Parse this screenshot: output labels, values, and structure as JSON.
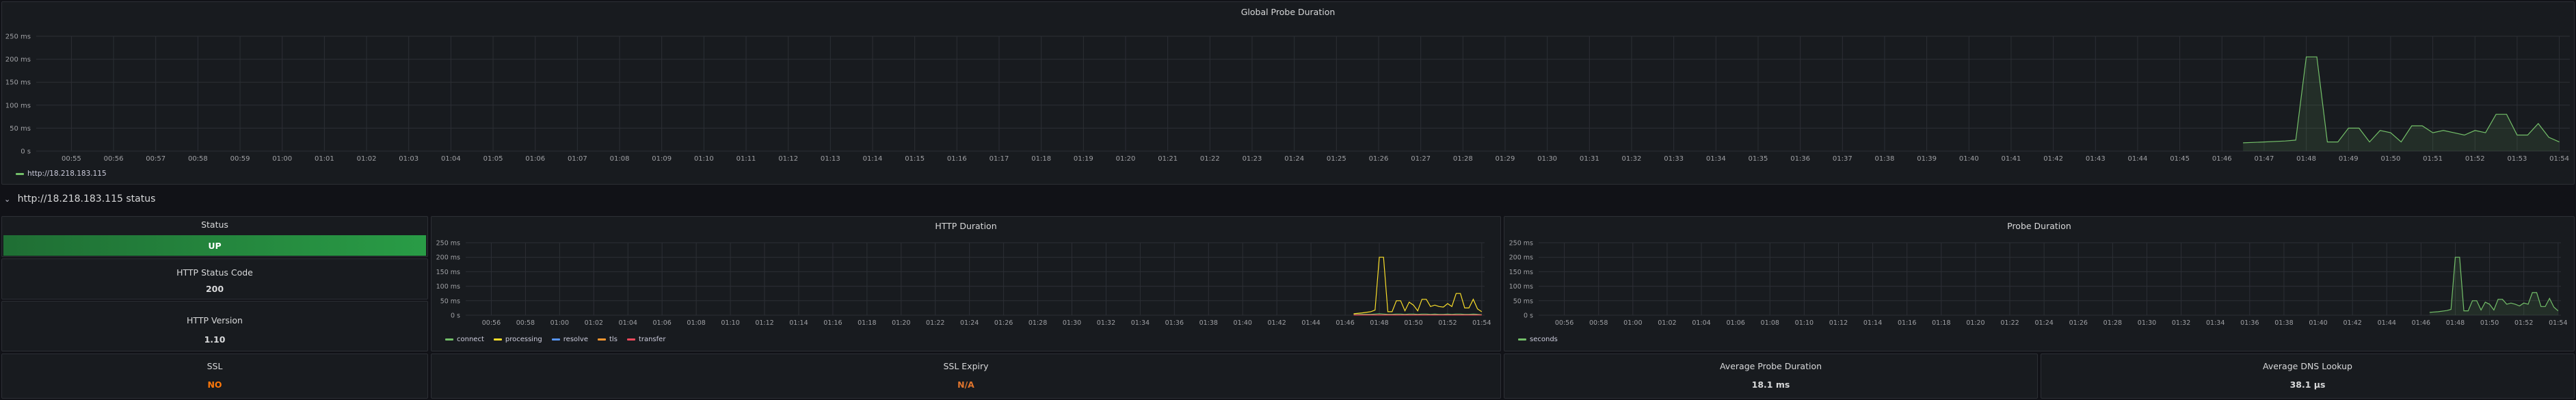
{
  "global_panel": {
    "title": "Global Probe Duration",
    "y_ticks": [
      "250 ms",
      "200 ms",
      "150 ms",
      "100 ms",
      "50 ms",
      "0 s"
    ],
    "x_ticks": [
      "00:55",
      "00:56",
      "00:57",
      "00:58",
      "00:59",
      "01:00",
      "01:01",
      "01:02",
      "01:03",
      "01:04",
      "01:05",
      "01:06",
      "01:07",
      "01:08",
      "01:09",
      "01:10",
      "01:11",
      "01:12",
      "01:13",
      "01:14",
      "01:15",
      "01:16",
      "01:17",
      "01:18",
      "01:19",
      "01:20",
      "01:21",
      "01:22",
      "01:23",
      "01:24",
      "01:25",
      "01:26",
      "01:27",
      "01:28",
      "01:29",
      "01:30",
      "01:31",
      "01:32",
      "01:33",
      "01:34",
      "01:35",
      "01:36",
      "01:37",
      "01:38",
      "01:39",
      "01:40",
      "01:41",
      "01:42",
      "01:43",
      "01:44",
      "01:45",
      "01:46",
      "01:47",
      "01:48",
      "01:49",
      "01:50",
      "01:51",
      "01:52",
      "01:53",
      "01:54"
    ],
    "legend": [
      "http://18.218.183.115"
    ],
    "color": "#73bf69"
  },
  "row": {
    "chevron": "v",
    "title": "http://18.218.183.115 status"
  },
  "status_panel": {
    "title": "Status",
    "value": "UP",
    "color": "#299c46"
  },
  "http_status_panel": {
    "title": "HTTP Status Code",
    "value": "200"
  },
  "http_version_panel": {
    "title": "HTTP Version",
    "value": "1.10"
  },
  "ssl_panel": {
    "title": "SSL",
    "value": "NO",
    "color": "#ff780a"
  },
  "ssl_expiry_panel": {
    "title": "SSL Expiry",
    "value": "N/A",
    "color": "#e0752d"
  },
  "avg_probe_panel": {
    "title": "Average Probe Duration",
    "value": "18.1 ms"
  },
  "avg_dns_panel": {
    "title": "Average DNS Lookup",
    "value": "38.1 µs"
  },
  "http_duration_panel": {
    "title": "HTTP Duration",
    "y_ticks": [
      "250 ms",
      "200 ms",
      "150 ms",
      "100 ms",
      "50 ms",
      "0 s"
    ],
    "x_ticks": [
      "00:56",
      "00:58",
      "01:00",
      "01:02",
      "01:04",
      "01:06",
      "01:08",
      "01:10",
      "01:12",
      "01:14",
      "01:16",
      "01:18",
      "01:20",
      "01:22",
      "01:24",
      "01:26",
      "01:28",
      "01:30",
      "01:32",
      "01:34",
      "01:36",
      "01:38",
      "01:40",
      "01:42",
      "01:44",
      "01:46",
      "01:48",
      "01:50",
      "01:52",
      "01:54"
    ],
    "legend": [
      {
        "name": "connect",
        "color": "#73bf69"
      },
      {
        "name": "processing",
        "color": "#fade2a"
      },
      {
        "name": "resolve",
        "color": "#5794f2"
      },
      {
        "name": "tls",
        "color": "#ff9830"
      },
      {
        "name": "transfer",
        "color": "#f2495c"
      }
    ]
  },
  "probe_duration_panel": {
    "title": "Probe Duration",
    "y_ticks": [
      "250 ms",
      "200 ms",
      "150 ms",
      "100 ms",
      "50 ms",
      "0 s"
    ],
    "x_ticks": [
      "00:56",
      "00:58",
      "01:00",
      "01:02",
      "01:04",
      "01:06",
      "01:08",
      "01:10",
      "01:12",
      "01:14",
      "01:16",
      "01:18",
      "01:20",
      "01:22",
      "01:24",
      "01:26",
      "01:28",
      "01:30",
      "01:32",
      "01:34",
      "01:36",
      "01:38",
      "01:40",
      "01:42",
      "01:44",
      "01:46",
      "01:48",
      "01:50",
      "01:52",
      "01:54"
    ],
    "legend": [
      {
        "name": "seconds",
        "color": "#73bf69"
      }
    ]
  },
  "chart_data": [
    {
      "type": "area",
      "title": "Global Probe Duration",
      "ylim": [
        0,
        250
      ],
      "x": [
        "01:46:30",
        "01:47",
        "01:47:30",
        "01:47:45",
        "01:48",
        "01:48:15",
        "01:48:30",
        "01:48:45",
        "01:49",
        "01:49:15",
        "01:49:30",
        "01:49:45",
        "01:50",
        "01:50:15",
        "01:50:30",
        "01:50:45",
        "01:51",
        "01:51:15",
        "01:51:30",
        "01:51:45",
        "01:52",
        "01:52:15",
        "01:52:30",
        "01:52:45",
        "01:53",
        "01:53:15",
        "01:53:30",
        "01:53:45",
        "01:54"
      ],
      "series": [
        {
          "name": "http://18.218.183.115",
          "values": [
            18,
            20,
            22,
            24,
            205,
            205,
            20,
            20,
            50,
            50,
            20,
            45,
            40,
            20,
            55,
            55,
            40,
            45,
            40,
            35,
            45,
            40,
            80,
            80,
            35,
            35,
            60,
            30,
            20
          ]
        }
      ]
    },
    {
      "type": "line",
      "title": "HTTP Duration",
      "ylim": [
        0,
        250
      ],
      "x": [
        "01:46:30",
        "01:47",
        "01:47:30",
        "01:47:45",
        "01:48",
        "01:48:15",
        "01:48:30",
        "01:48:45",
        "01:49",
        "01:49:15",
        "01:49:30",
        "01:49:45",
        "01:50",
        "01:50:15",
        "01:50:30",
        "01:50:45",
        "01:51",
        "01:51:15",
        "01:51:30",
        "01:51:45",
        "01:52",
        "01:52:15",
        "01:52:30",
        "01:52:45",
        "01:53",
        "01:53:15",
        "01:53:30",
        "01:53:45",
        "01:54"
      ],
      "series": [
        {
          "name": "processing",
          "values": [
            5,
            8,
            12,
            18,
            200,
            200,
            12,
            12,
            50,
            50,
            15,
            45,
            35,
            15,
            55,
            55,
            30,
            35,
            30,
            28,
            40,
            30,
            75,
            75,
            25,
            25,
            55,
            22,
            12
          ]
        },
        {
          "name": "connect",
          "values": [
            2,
            3,
            3,
            4,
            5,
            4,
            3,
            3,
            4,
            4,
            3,
            4,
            4,
            3,
            4,
            4,
            3,
            4,
            3,
            3,
            4,
            3,
            4,
            4,
            3,
            3,
            4,
            3,
            2
          ]
        },
        {
          "name": "transfer",
          "values": [
            1,
            1,
            1,
            1,
            1,
            1,
            1,
            1,
            1,
            1,
            1,
            1,
            1,
            1,
            1,
            1,
            1,
            1,
            1,
            1,
            1,
            1,
            1,
            1,
            1,
            1,
            1,
            1,
            1
          ]
        }
      ]
    },
    {
      "type": "line",
      "title": "Probe Duration",
      "ylim": [
        0,
        250
      ],
      "x": [
        "01:46:30",
        "01:47",
        "01:47:30",
        "01:47:45",
        "01:48",
        "01:48:15",
        "01:48:30",
        "01:48:45",
        "01:49",
        "01:49:15",
        "01:49:30",
        "01:49:45",
        "01:50",
        "01:50:15",
        "01:50:30",
        "01:50:45",
        "01:51",
        "01:51:15",
        "01:51:30",
        "01:51:45",
        "01:52",
        "01:52:15",
        "01:52:30",
        "01:52:45",
        "01:53",
        "01:53:15",
        "01:53:30",
        "01:53:45",
        "01:54"
      ],
      "series": [
        {
          "name": "seconds",
          "values": [
            10,
            12,
            16,
            20,
            200,
            200,
            15,
            15,
            50,
            50,
            18,
            45,
            38,
            18,
            55,
            55,
            38,
            42,
            38,
            32,
            42,
            38,
            78,
            78,
            30,
            30,
            58,
            28,
            15
          ]
        }
      ]
    }
  ]
}
